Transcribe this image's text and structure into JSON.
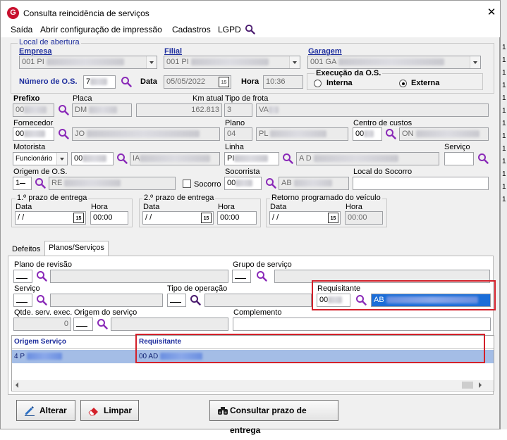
{
  "window": {
    "title": "Consulta reincidência de serviços",
    "close": "✕"
  },
  "menu": [
    "Saída",
    "Abrir configuração de impressão",
    "Cadastros",
    "LGPD"
  ],
  "local": {
    "group_title": "Local de abertura",
    "empresa_label": "Empresa",
    "empresa_value": "001 PI",
    "filial_label": "Filial",
    "filial_value": "001 PI",
    "garagem_label": "Garagem",
    "garagem_value": "001 GA"
  },
  "os": {
    "numero_label": "Número de O.S.",
    "numero_value": "7",
    "data_label": "Data",
    "data_value": "05/05/2022",
    "hora_label": "Hora",
    "hora_value": "10:36",
    "execucao_title": "Execução da O.S.",
    "interna": "Interna",
    "externa": "Externa"
  },
  "cal_icon": "15",
  "vehicle": {
    "prefixo_label": "Prefixo",
    "prefixo_value": "00",
    "placa_label": "Placa",
    "placa_value": "DM",
    "km_label": "Km atual",
    "km_value": "162.813",
    "tipo_frota_label": "Tipo de frota",
    "tipo_frota_code": "3",
    "tipo_frota_value": "VA"
  },
  "fornecedor": {
    "label": "Fornecedor",
    "code": "00",
    "name": "JO",
    "plano_label": "Plano",
    "plano_code": "04",
    "plano_value": "PL",
    "centro_label": "Centro de custos",
    "centro_code": "00",
    "centro_value": "ON"
  },
  "motorista": {
    "label": "Motorista",
    "type": "Funcionário",
    "code": "00",
    "name": "IA",
    "linha_label": "Linha",
    "linha_code": "PI",
    "linha_value": "A D",
    "servico_label": "Serviço"
  },
  "origem": {
    "label": "Origem de O.S.",
    "code": "1",
    "name": "RE",
    "socorro_label": "Socorro",
    "socorrista_label": "Socorrista",
    "socorrista_code": "00",
    "socorrista_name": "AB",
    "local_socorro_label": "Local do Socorro"
  },
  "prazos": {
    "p1_title": "1.º prazo de entrega",
    "p2_title": "2.º prazo de entrega",
    "ret_title": "Retorno programado do veículo",
    "data_label": "Data",
    "hora_label": "Hora",
    "p1_data": " / /",
    "p1_hora": "00:00",
    "p2_data": " / /",
    "p2_hora": "00:00",
    "ret_data": " / /",
    "ret_hora": "00:00"
  },
  "tabs": [
    "Defeitos",
    "Planos/Serviços"
  ],
  "planos": {
    "plano_revisao_label": "Plano de revisão",
    "grupo_servico_label": "Grupo de serviço",
    "servico_label": "Serviço",
    "tipo_operacao_label": "Tipo de operação",
    "requisitante_label": "Requisitante",
    "requisitante_code": "00",
    "requisitante_name": "AB",
    "qtde_label": "Qtde. serv. exec.",
    "qtde_value": "0",
    "origem_servico_label": "Origem do serviço",
    "complemento_label": "Complemento"
  },
  "grid": {
    "columns": [
      "Origem Serviço",
      "Requisitante"
    ],
    "rows": [
      [
        "4 P",
        "00 AD"
      ]
    ]
  },
  "buttons": {
    "alterar": "Alterar",
    "limpar": "Limpar",
    "consultar": "Consultar prazo de entrega"
  },
  "colors": {
    "accent_red": "#d3202a",
    "selection": "#1b6dd8",
    "label_blue": "#1f2f9e"
  }
}
